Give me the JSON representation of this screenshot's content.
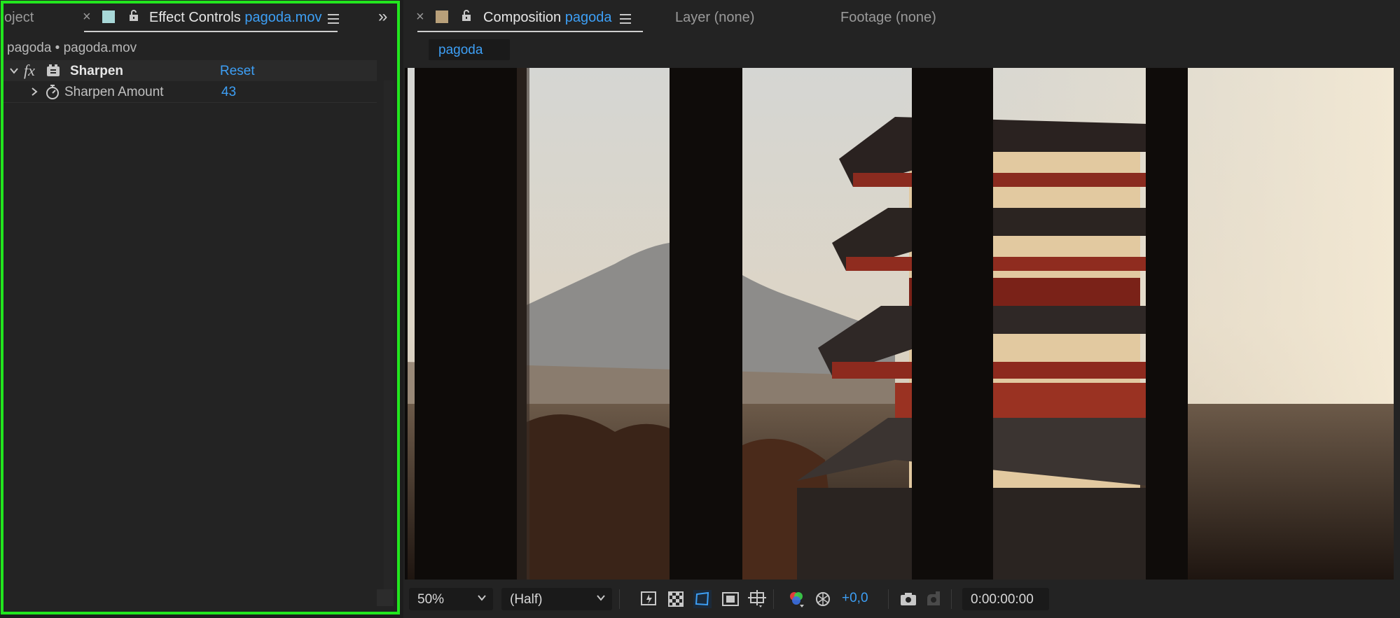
{
  "left_panel": {
    "tabs": {
      "project_label": "oject",
      "close_symbol": "×",
      "effect_controls_label": "Effect Controls",
      "effect_controls_file": "pagoda.mov"
    },
    "overflow_symbol": "»",
    "breadcrumb": "pagoda • pagoda.mov",
    "effect": {
      "name": "Sharpen",
      "reset_label": "Reset",
      "property_label": "Sharpen Amount",
      "property_value": "43"
    },
    "highlight_color": "#22e61e"
  },
  "right_panel": {
    "tabs": {
      "close_symbol": "×",
      "composition_label": "Composition",
      "composition_name": "pagoda",
      "layer_label": "Layer (none)",
      "footage_label": "Footage (none)"
    },
    "breadcrumb_chip": "pagoda",
    "toolbar": {
      "zoom": "50%",
      "resolution": "(Half)",
      "exposure": "+0,0",
      "timecode": "0:00:00:00"
    }
  },
  "icons": {
    "effect": "fx-icon",
    "stopwatch": "stopwatch-icon",
    "lock": "lock-icon",
    "menu": "hamburger-menu-icon"
  },
  "colors": {
    "accent_blue": "#3d9ff5",
    "panel_bg": "#232323",
    "swatch_effect": "#a8d8d8",
    "swatch_comp": "#b8a07a"
  }
}
